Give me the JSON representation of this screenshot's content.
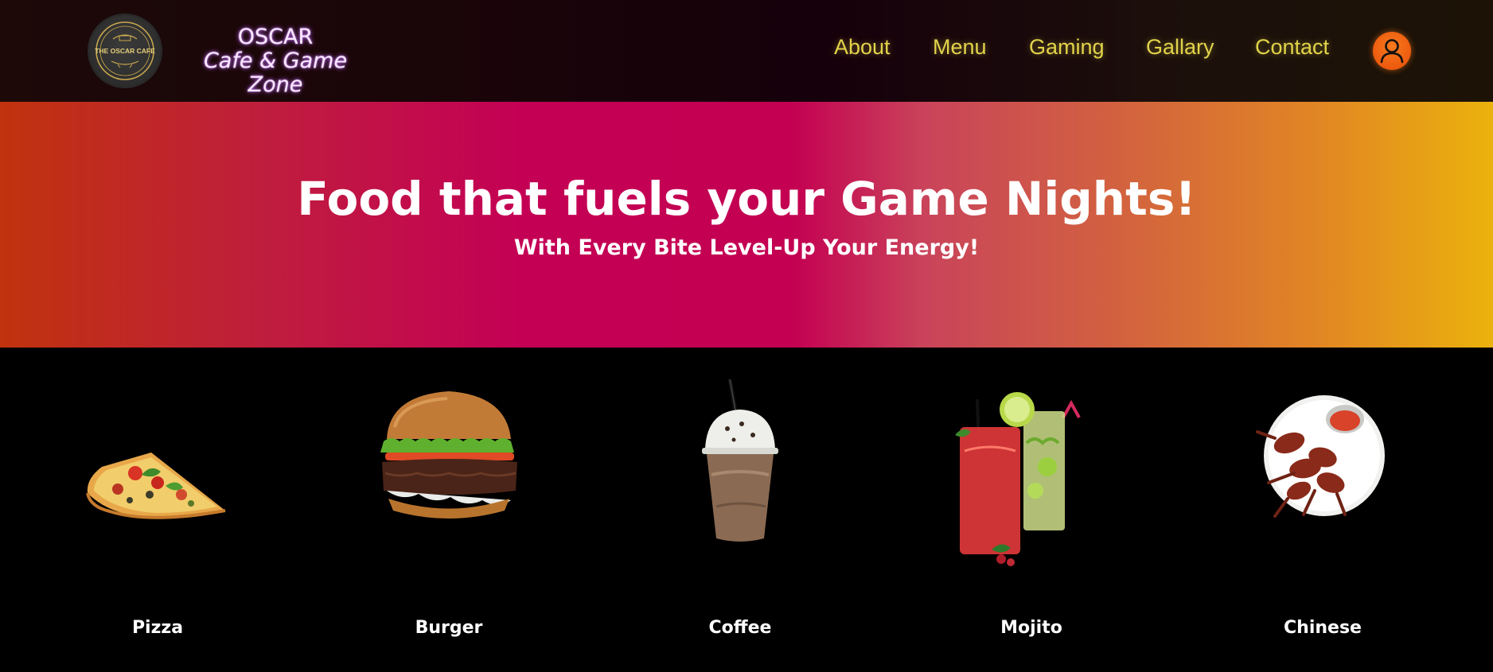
{
  "header": {
    "logo_text": "THE OSCAR CAFE",
    "brand_name": "OSCAR",
    "brand_tagline": "Cafe & Game Zone",
    "nav": [
      "About",
      "Menu",
      "Gaming",
      "Gallary",
      "Contact"
    ],
    "user_icon": "user-icon"
  },
  "hero": {
    "title": "Food that fuels your Game Nights!",
    "subtitle": "With Every Bite Level-Up Your Energy!"
  },
  "menu_items": [
    {
      "label": "Pizza",
      "icon": "pizza-image"
    },
    {
      "label": "Burger",
      "icon": "burger-image"
    },
    {
      "label": "Coffee",
      "icon": "coffee-image"
    },
    {
      "label": "Mojito",
      "icon": "mojito-image"
    },
    {
      "label": "Chinese",
      "icon": "chinese-image"
    }
  ],
  "colors": {
    "nav_text": "#e2d34a",
    "brand_glow": "#c266ff",
    "user_button": "#f77a1e",
    "hero_start": "#c0330d",
    "hero_mid": "#c40055",
    "hero_end": "#ebb20d"
  }
}
